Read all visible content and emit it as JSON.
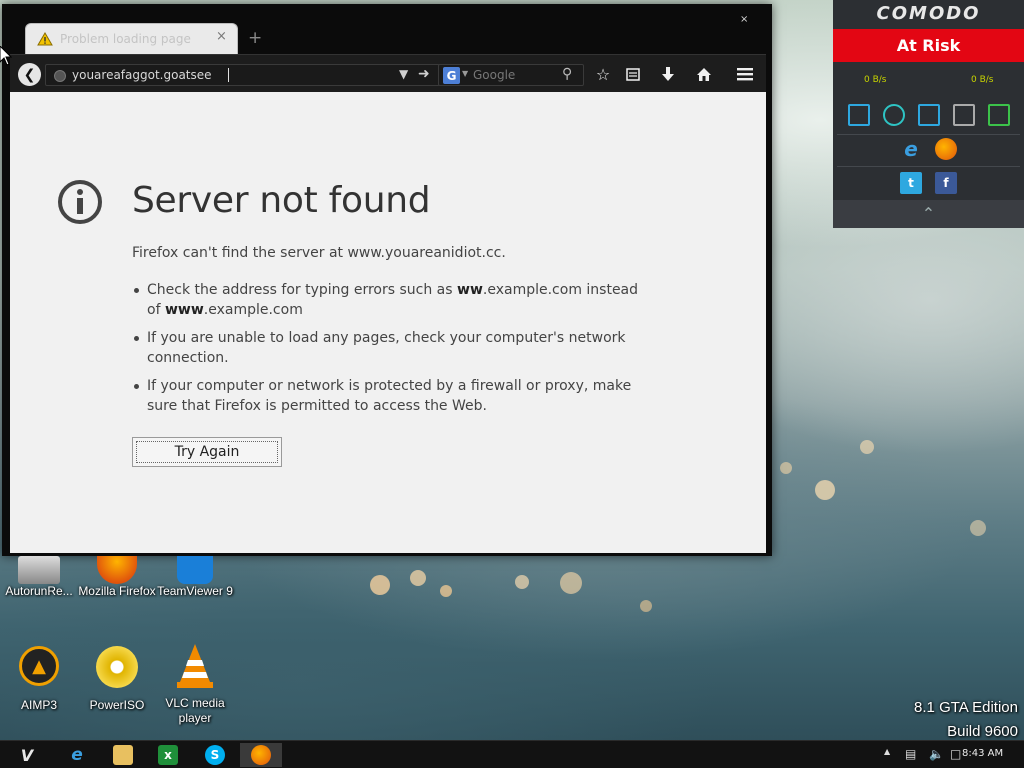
{
  "browser": {
    "tab_title": "Problem loading page",
    "tab_close": "×",
    "new_tab": "+",
    "window_close": "×",
    "url": "youareafaggot.goatsee",
    "search_engine": "G",
    "search_placeholder": "Google"
  },
  "error_page": {
    "title": "Server not found",
    "description": "Firefox can't find the server at www.youareanidiot.cc.",
    "bullets": [
      {
        "before": "Check the address for typing errors such as ",
        "bold1": "ww",
        "middle": ".example.com instead of ",
        "bold2": "www",
        "after": ".example.com"
      },
      {
        "text": "If you are unable to load any pages, check your computer's network connection."
      },
      {
        "text": "If your computer or network is protected by a firewall or proxy, make sure that Firefox is permitted to access the Web."
      }
    ],
    "try_again": "Try Again"
  },
  "comodo": {
    "logo": "COMODO",
    "status": "At Risk",
    "download_speed": "0 B/s",
    "upload_speed": "0 B/s",
    "status_color": "#e30613"
  },
  "desktop": {
    "icons": [
      {
        "label": "AutorunRe...",
        "icon": "autorun-icon"
      },
      {
        "label": "Mozilla Firefox",
        "icon": "firefox-icon"
      },
      {
        "label": "TeamViewer 9",
        "icon": "teamviewer-icon"
      },
      {
        "label": "AIMP3",
        "icon": "aimp-icon"
      },
      {
        "label": "PowerISO",
        "icon": "poweriso-icon"
      },
      {
        "label": "VLC media player",
        "icon": "vlc-icon"
      }
    ],
    "watermark_line1": "8.1 GTA Edition",
    "watermark_line2": "Build 9600"
  },
  "taskbar": {
    "start_label": "V",
    "clock": "8:43 AM"
  }
}
